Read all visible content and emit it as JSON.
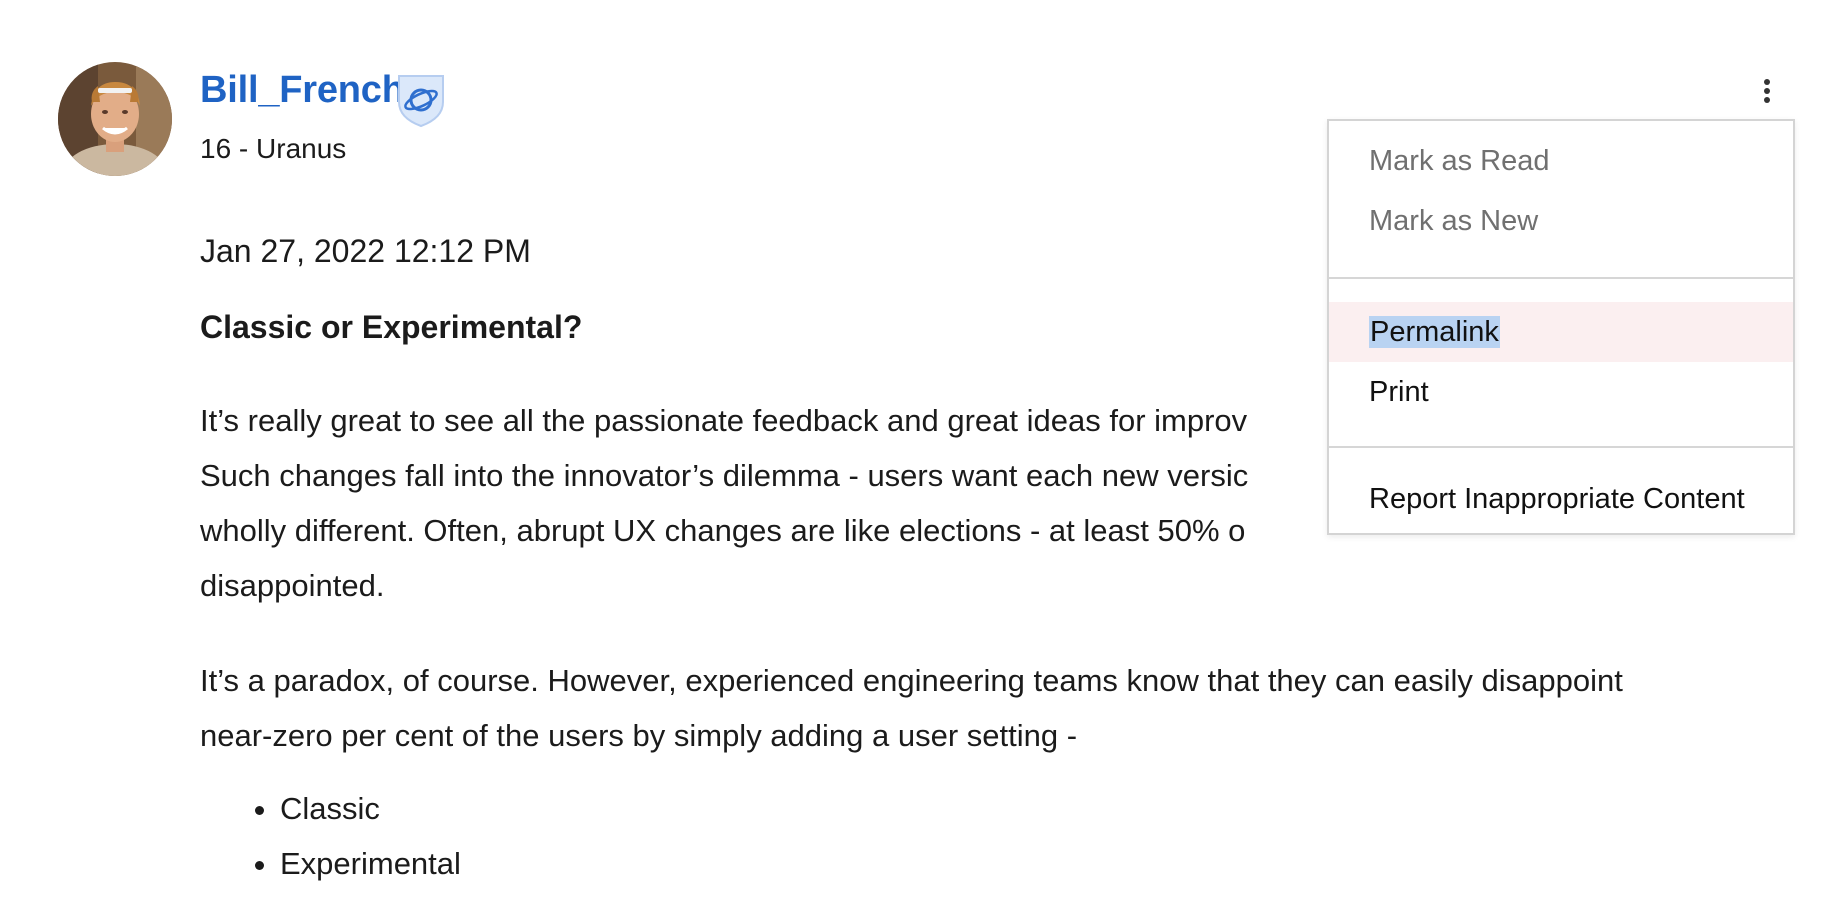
{
  "author": {
    "name": "Bill_French",
    "rank": "16 - Uranus",
    "badge_icon": "planet-shield-icon"
  },
  "post": {
    "date": "Jan 27, 2022 12:12 PM",
    "subject": "Classic or Experimental?",
    "paragraph1": "It’s really great to see all the passionate feedback and great ideas for improv\nSuch changes fall into the innovator’s dilemma - users want each new versic\nwholly different. Often, abrupt UX changes are like elections - at least 50% o\ndisappointed.",
    "paragraph2": "It’s a paradox, of course. However, experienced engineering teams know that they can easily disappoint\nnear-zero per cent of the users by simply adding a user setting -",
    "bullets": [
      "Classic",
      "Experimental"
    ]
  },
  "options_icon": "kebab-menu-icon",
  "menu": {
    "mark_read": "Mark as Read",
    "mark_new": "Mark as New",
    "permalink": "Permalink",
    "print": "Print",
    "report": "Report Inappropriate Content"
  },
  "colors": {
    "link": "#1f63c4",
    "menu_hover": "#fbeff0",
    "text_selection": "#b9d3f2",
    "muted_text": "#707070"
  }
}
